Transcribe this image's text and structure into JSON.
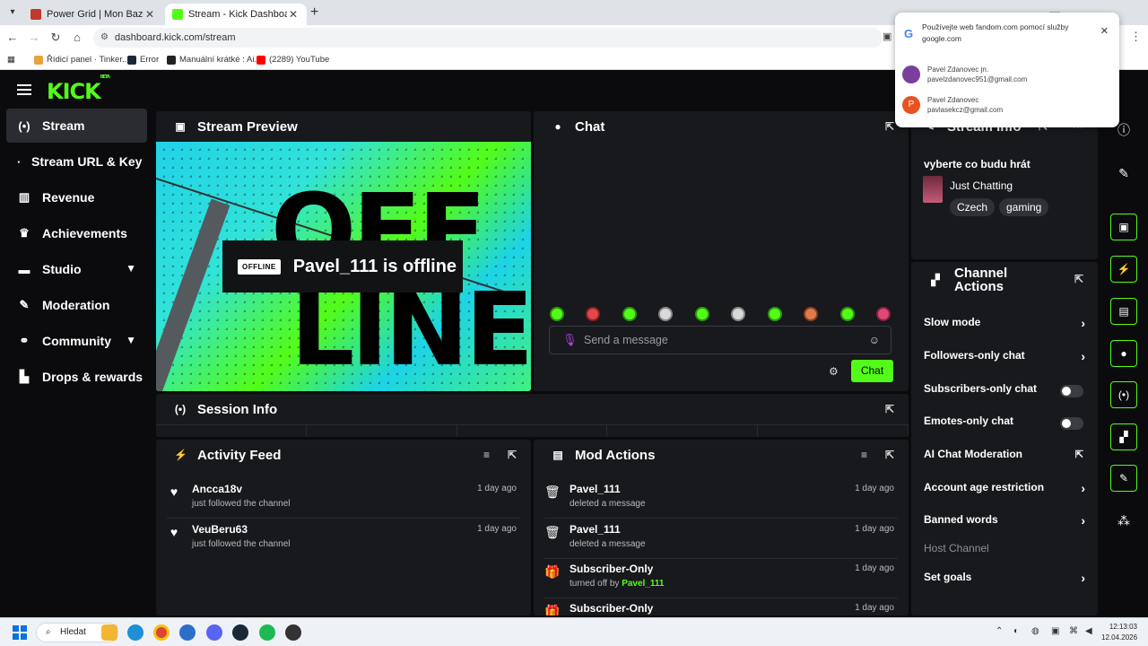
{
  "browser": {
    "tabs": [
      {
        "title": "Power Grid | Mon Bazou Wiki |",
        "active": false
      },
      {
        "title": "Stream - Kick Dashboard",
        "active": true
      }
    ],
    "url": "dashboard.kick.com/stream",
    "bookmarks": [
      "Řídicí panel · Tinker...",
      "Error",
      "Manuální krátké : Ai...",
      "(2289) YouTube"
    ]
  },
  "google_popup": {
    "title": "Používejte web fandom.com pomocí služby google.com",
    "accounts": [
      {
        "name": "Pavel Zdanovec jn.",
        "email": "pavelzdanovec951@gmail.com",
        "avatar": ""
      },
      {
        "name": "Pavel Zdanovec",
        "email": "pavlasekcz@gmail.com",
        "avatar": "P"
      }
    ]
  },
  "kick": {
    "logo": "KICK",
    "logo_badge": "BETA",
    "sidebar": [
      {
        "label": "Stream",
        "icon": "broadcast-icon",
        "active": true
      },
      {
        "label": "Stream URL & Key",
        "icon": "dot-icon"
      },
      {
        "label": "Revenue",
        "icon": "chart-icon"
      },
      {
        "label": "Achievements",
        "icon": "trophy-icon"
      },
      {
        "label": "Studio",
        "icon": "studio-icon",
        "expandable": true
      },
      {
        "label": "Moderation",
        "icon": "wrench-icon"
      },
      {
        "label": "Community",
        "icon": "community-icon",
        "expandable": true
      },
      {
        "label": "Drops & rewards",
        "icon": "drops-icon"
      }
    ],
    "stream_preview": {
      "title": "Stream Preview",
      "offline_badge": "OFFLINE",
      "offline_text": "Pavel_111 is offline",
      "bg_line1": "OFF",
      "bg_line2": "LINE"
    },
    "chat": {
      "title": "Chat",
      "placeholder": "Send a message",
      "send_label": "Chat"
    },
    "session_info": {
      "title": "Session Info"
    },
    "activity_feed": {
      "title": "Activity Feed",
      "items": [
        {
          "name": "Ancca18v",
          "desc": "just followed the channel",
          "time": "1 day ago"
        },
        {
          "name": "VeuBeru63",
          "desc": "just followed the channel",
          "time": "1 day ago"
        }
      ]
    },
    "mod_actions": {
      "title": "Mod Actions",
      "items": [
        {
          "name": "Pavel_111",
          "desc": "deleted a message",
          "time": "1 day ago"
        },
        {
          "name": "Pavel_111",
          "desc": "deleted a message",
          "time": "1 day ago"
        },
        {
          "name": "Subscriber-Only",
          "desc": "turned off by",
          "actor": "Pavel_111",
          "time": "1 day ago"
        },
        {
          "name": "Subscriber-Only",
          "desc": "",
          "time": "1 day ago"
        }
      ]
    },
    "stream_info": {
      "title": "Stream Info",
      "stream_title": "vyberte co budu hrát",
      "category": "Just Chatting",
      "tags": [
        "Czech",
        "gaming"
      ]
    },
    "channel_actions": {
      "title_line1": "Channel",
      "title_line2": "Actions",
      "items": [
        {
          "label": "Slow mode",
          "control": "arrow"
        },
        {
          "label": "Followers-only chat",
          "control": "arrow"
        },
        {
          "label": "Subscribers-only chat",
          "control": "toggle"
        },
        {
          "label": "Emotes-only chat",
          "control": "toggle"
        },
        {
          "label": "AI Chat Moderation",
          "control": "external"
        },
        {
          "label": "Account age restriction",
          "control": "arrow"
        },
        {
          "label": "Banned words",
          "control": "arrow"
        },
        {
          "label": "Host Channel",
          "control": "none"
        },
        {
          "label": "Set goals",
          "control": "arrow"
        }
      ]
    }
  },
  "taskbar": {
    "search_label": "Hledat",
    "time": "12:13:03",
    "date": "12.04.2026"
  },
  "colors": {
    "accent": "#53fc18",
    "panel": "#18191c",
    "background": "#0b0b0d"
  }
}
